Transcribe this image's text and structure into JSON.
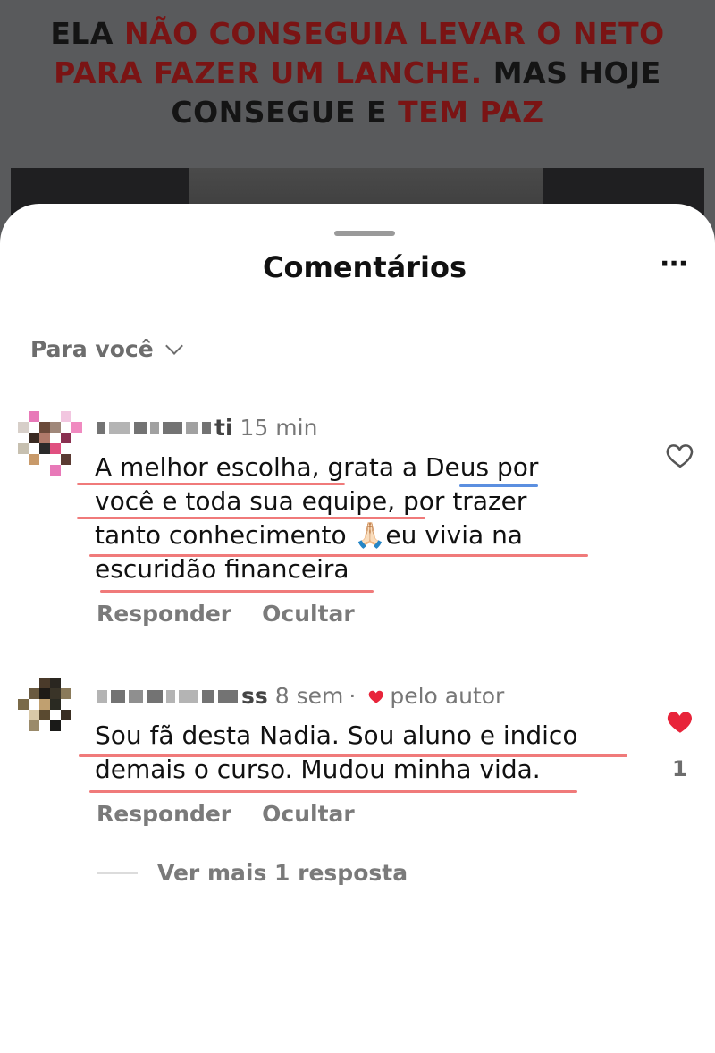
{
  "video": {
    "caption_parts": [
      {
        "text": "ELA ",
        "color": "dark"
      },
      {
        "text": "NÃO CONSEGUIA LEVAR O NETO",
        "color": "red"
      },
      {
        "text": "PARA FAZER UM LANCHE.",
        "color": "red"
      },
      {
        "text": " MAS HOJE",
        "color": "dark"
      },
      {
        "text": "CONSEGUE E ",
        "color": "dark"
      },
      {
        "text": "TEM PAZ",
        "color": "red"
      }
    ]
  },
  "sheet": {
    "title": "Comentários",
    "more_icon": "more-horizontal-icon",
    "filter_label": "Para você"
  },
  "comments": [
    {
      "name_tail": "ti",
      "time": "15 min",
      "text": "A melhor escolha, grata a Deus por você e toda sua equipe, por trazer tanto conhecimento 🙏🏻eu vivia na escuridão financeira",
      "reply_label": "Responder",
      "hide_label": "Ocultar",
      "liked": false
    },
    {
      "name_tail": "ss",
      "time": "8 sem",
      "liked_by_author_label": "pelo autor",
      "text": "Sou fã desta Nadia. Sou aluno e indico demais o curso. Mudou minha vida.",
      "reply_label": "Responder",
      "hide_label": "Ocultar",
      "liked": true,
      "like_count": "1"
    }
  ],
  "view_more_replies": "Ver mais 1 resposta",
  "colors": {
    "accent_red": "#e8243a",
    "underline_red": "#f07a7a",
    "underline_blue": "#5b8fe0",
    "caption_red": "#7a1414"
  }
}
